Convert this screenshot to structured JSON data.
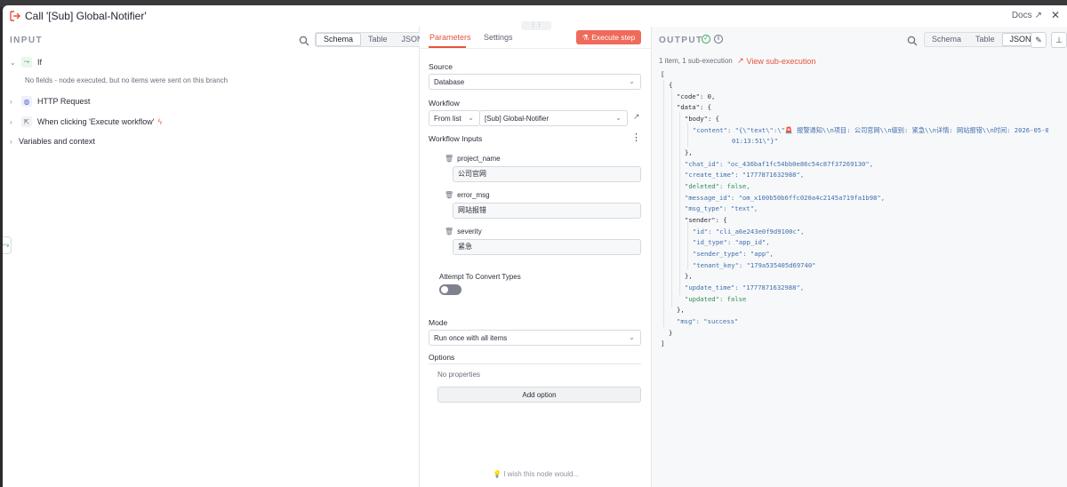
{
  "modal": {
    "title": "Call '[Sub] Global-Notifier'",
    "docs_label": "Docs",
    "close_label": "✕"
  },
  "input_panel": {
    "title": "INPUT",
    "view_tabs": [
      "Schema",
      "Table",
      "JSON"
    ],
    "active_view": "Schema",
    "tree": [
      {
        "label": "If",
        "expanded": true,
        "icon": "if-branch-icon"
      },
      {
        "label": "HTTP Request",
        "expanded": false,
        "icon": "globe-icon"
      },
      {
        "label": "When clicking 'Execute workflow'",
        "expanded": false,
        "icon": "pointer-icon"
      },
      {
        "label": "Variables and context",
        "expanded": false
      }
    ],
    "no_fields_text": "No fields - node executed, but no items were sent on this branch"
  },
  "parameters_panel": {
    "tabs": [
      "Parameters",
      "Settings"
    ],
    "active_tab": "Parameters",
    "execute_label": "Execute step",
    "source_label": "Source",
    "source_value": "Database",
    "workflow_label": "Workflow",
    "workflow_mode": "From list",
    "workflow_value": "[Sub] Global-Notifier",
    "workflow_inputs_label": "Workflow Inputs",
    "inputs": [
      {
        "name": "project_name",
        "value": "公司官网"
      },
      {
        "name": "error_msg",
        "value": "网站报错"
      },
      {
        "name": "severity",
        "value": "紧急"
      }
    ],
    "attempt_convert_label": "Attempt To Convert Types",
    "attempt_convert_on": false,
    "mode_label": "Mode",
    "mode_value": "Run once with all items",
    "options_label": "Options",
    "no_properties": "No properties",
    "add_option_label": "Add option",
    "wish_text": "I wish this node would..."
  },
  "output_panel": {
    "title": "OUTPUT",
    "meta": "1 item, 1 sub-execution",
    "view_sub_label": "View sub-execution",
    "view_tabs": [
      "Schema",
      "Table",
      "JSON"
    ],
    "active_view": "JSON",
    "json_lines": [
      "[",
      "{",
      "\"code\": 0,",
      "\"data\": {",
      "\"body\": {",
      "\"content\": \"{\\\"text\\\":\\\"🚨 报警通知\\\\n项目: 公司官网\\\\n级别: 紧急\\\\n详情: 网站报错\\\\n时间: 2026-05-04",
      "01:13:51\\\"}\"",
      "},",
      "\"chat_id\": \"oc_436baf1fc54bb0e86c54c87f37269130\",",
      "\"create_time\": \"1777871632988\",",
      "\"deleted\": false,",
      "\"message_id\": \"om_x100b50b6ffc020a4c2145a719fa1b98\",",
      "\"msg_type\": \"text\",",
      "\"sender\": {",
      "\"id\": \"cli_a6e243e0f9d9100c\",",
      "\"id_type\": \"app_id\",",
      "\"sender_type\": \"app\",",
      "\"tenant_key\": \"179a535405d69740\"",
      "},",
      "\"update_time\": \"1777871632988\",",
      "\"updated\": false",
      "},",
      "\"msg\": \"success\"",
      "}",
      "]"
    ]
  }
}
